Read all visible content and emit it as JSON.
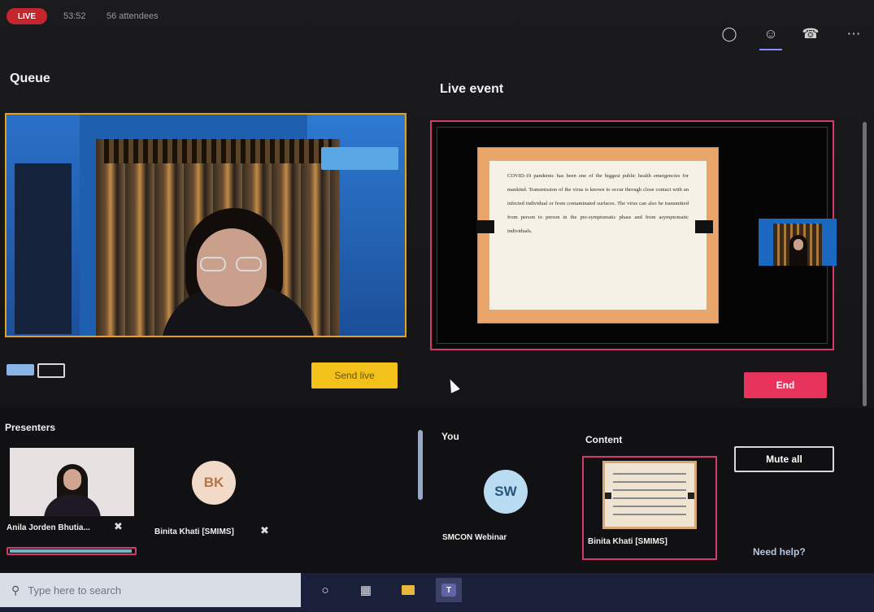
{
  "topbar": {
    "live_label": "LIVE",
    "timer": "53:52",
    "attendees": "56 attendees"
  },
  "queue": {
    "title": "Queue",
    "send_live_label": "Send live"
  },
  "live_event": {
    "title": "Live event",
    "end_label": "End",
    "document_text": "COVID-19 pandemic has been one of the biggest public health emergencies for mankind. Transmission of the virus is known to occur through close contact with an infected individual or from contaminated surfaces. The virus can also be transmitted from person to person in the pre-symptomatic phase and from asymptomatic individuals."
  },
  "presenters": {
    "title": "Presenters",
    "items": [
      {
        "name": "Anila Jorden Bhutia..."
      },
      {
        "name": "Binita Khati [SMIMS]",
        "initials": "BK"
      }
    ]
  },
  "you": {
    "title": "You",
    "name": "SMCON Webinar",
    "initials": "SW"
  },
  "content": {
    "title": "Content",
    "name": "Binita Khati [SMIMS]"
  },
  "controls": {
    "mute_all_label": "Mute all",
    "help_label": "Need help?"
  },
  "taskbar": {
    "search_placeholder": "Type here to search"
  },
  "colors": {
    "live_red": "#c4262e",
    "queue_border": "#e3a21a",
    "live_border": "#d23b6a",
    "send_live_yellow": "#f2c21b",
    "end_pink": "#e8345d"
  }
}
